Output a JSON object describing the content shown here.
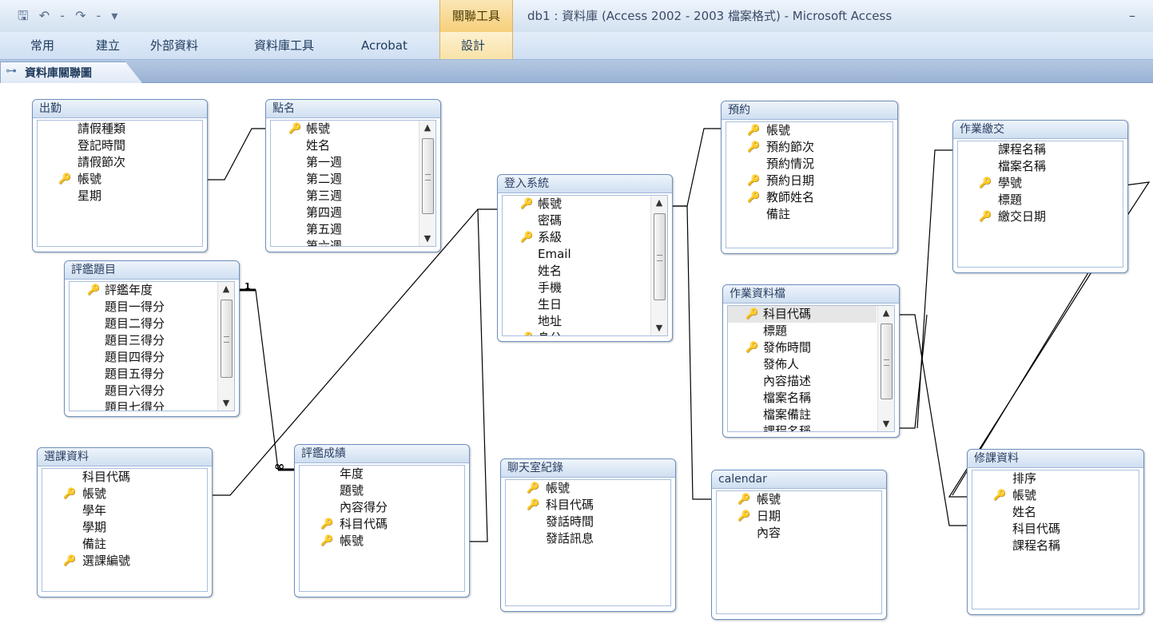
{
  "title_bar": {
    "quick_access": "🖫 ↶ - ↷ - ▾",
    "context_tab_label": "關聯工具",
    "window_title": "db1 : 資料庫 (Access 2002 - 2003 檔案格式) - Microsoft Access",
    "minimize": "–"
  },
  "ribbon": {
    "tabs": [
      "常用",
      "建立",
      "外部資料",
      "資料庫工具",
      "Acrobat"
    ],
    "context_tab": "設計"
  },
  "document_tab": {
    "icon": "relationships-icon",
    "label": "資料庫關聯圖"
  },
  "relationship": {
    "one_symbol": "1",
    "many_symbol": "∞"
  },
  "tables": {
    "chuqin": {
      "name": "出勤",
      "fields": [
        {
          "name": "請假種類",
          "key": false
        },
        {
          "name": "登記時間",
          "key": false
        },
        {
          "name": "請假節次",
          "key": false
        },
        {
          "name": "帳號",
          "key": true
        },
        {
          "name": "星期",
          "key": false
        }
      ]
    },
    "dianming": {
      "name": "點名",
      "fields": [
        {
          "name": "帳號",
          "key": true
        },
        {
          "name": "姓名",
          "key": false
        },
        {
          "name": "第一週",
          "key": false
        },
        {
          "name": "第二週",
          "key": false
        },
        {
          "name": "第三週",
          "key": false
        },
        {
          "name": "第四週",
          "key": false
        },
        {
          "name": "第五週",
          "key": false
        },
        {
          "name": "第六週",
          "key": false
        }
      ]
    },
    "pingjian_timu": {
      "name": "評鑑題目",
      "fields": [
        {
          "name": "評鑑年度",
          "key": true
        },
        {
          "name": "題目一得分",
          "key": false
        },
        {
          "name": "題目二得分",
          "key": false
        },
        {
          "name": "題目三得分",
          "key": false
        },
        {
          "name": "題目四得分",
          "key": false
        },
        {
          "name": "題目五得分",
          "key": false
        },
        {
          "name": "題目六得分",
          "key": false
        },
        {
          "name": "題目七得分",
          "key": false
        }
      ]
    },
    "denglu": {
      "name": "登入系統",
      "fields": [
        {
          "name": "帳號",
          "key": true
        },
        {
          "name": "密碼",
          "key": false
        },
        {
          "name": "系級",
          "key": true
        },
        {
          "name": "Email",
          "key": false
        },
        {
          "name": "姓名",
          "key": false
        },
        {
          "name": "手機",
          "key": false
        },
        {
          "name": "生日",
          "key": false
        },
        {
          "name": "地址",
          "key": false
        },
        {
          "name": "身分",
          "key": true
        }
      ]
    },
    "yuyue": {
      "name": "預約",
      "fields": [
        {
          "name": "帳號",
          "key": true
        },
        {
          "name": "預約節次",
          "key": true
        },
        {
          "name": "預約情況",
          "key": false
        },
        {
          "name": "預約日期",
          "key": true
        },
        {
          "name": "教師姓名",
          "key": true
        },
        {
          "name": "備註",
          "key": false
        }
      ]
    },
    "zuoye_jiaojiao": {
      "name": "作業繳交",
      "fields": [
        {
          "name": "課程名稱",
          "key": false
        },
        {
          "name": "檔案名稱",
          "key": false
        },
        {
          "name": "學號",
          "key": true
        },
        {
          "name": "標題",
          "key": false
        },
        {
          "name": "繳交日期",
          "key": true
        }
      ]
    },
    "zuoye_ziliao": {
      "name": "作業資料檔",
      "fields": [
        {
          "name": "科目代碼",
          "key": true
        },
        {
          "name": "標題",
          "key": false
        },
        {
          "name": "發佈時間",
          "key": true
        },
        {
          "name": "發佈人",
          "key": false
        },
        {
          "name": "內容描述",
          "key": false
        },
        {
          "name": "檔案名稱",
          "key": false
        },
        {
          "name": "檔案備註",
          "key": false
        },
        {
          "name": "課程名稱",
          "key": false
        }
      ]
    },
    "xuanke": {
      "name": "選課資料",
      "fields": [
        {
          "name": "科目代碼",
          "key": false
        },
        {
          "name": "帳號",
          "key": true
        },
        {
          "name": "學年",
          "key": false
        },
        {
          "name": "學期",
          "key": false
        },
        {
          "name": "備註",
          "key": false
        },
        {
          "name": "選課編號",
          "key": true
        }
      ]
    },
    "pingjian_chengji": {
      "name": "評鑑成績",
      "fields": [
        {
          "name": "年度",
          "key": false
        },
        {
          "name": "題號",
          "key": false
        },
        {
          "name": "內容得分",
          "key": false
        },
        {
          "name": "科目代碼",
          "key": true
        },
        {
          "name": "帳號",
          "key": true
        }
      ]
    },
    "liaotian": {
      "name": "聊天室紀錄",
      "fields": [
        {
          "name": "帳號",
          "key": true
        },
        {
          "name": "科目代碼",
          "key": true
        },
        {
          "name": "發話時間",
          "key": false
        },
        {
          "name": "發話訊息",
          "key": false
        }
      ]
    },
    "calendar": {
      "name": "calendar",
      "fields": [
        {
          "name": "帳號",
          "key": true
        },
        {
          "name": "日期",
          "key": true
        },
        {
          "name": "內容",
          "key": false
        }
      ]
    },
    "xiuke": {
      "name": "修課資料",
      "fields": [
        {
          "name": "排序",
          "key": false
        },
        {
          "name": "帳號",
          "key": true
        },
        {
          "name": "姓名",
          "key": false
        },
        {
          "name": "科目代碼",
          "key": false
        },
        {
          "name": "課程名稱",
          "key": false
        }
      ]
    }
  }
}
